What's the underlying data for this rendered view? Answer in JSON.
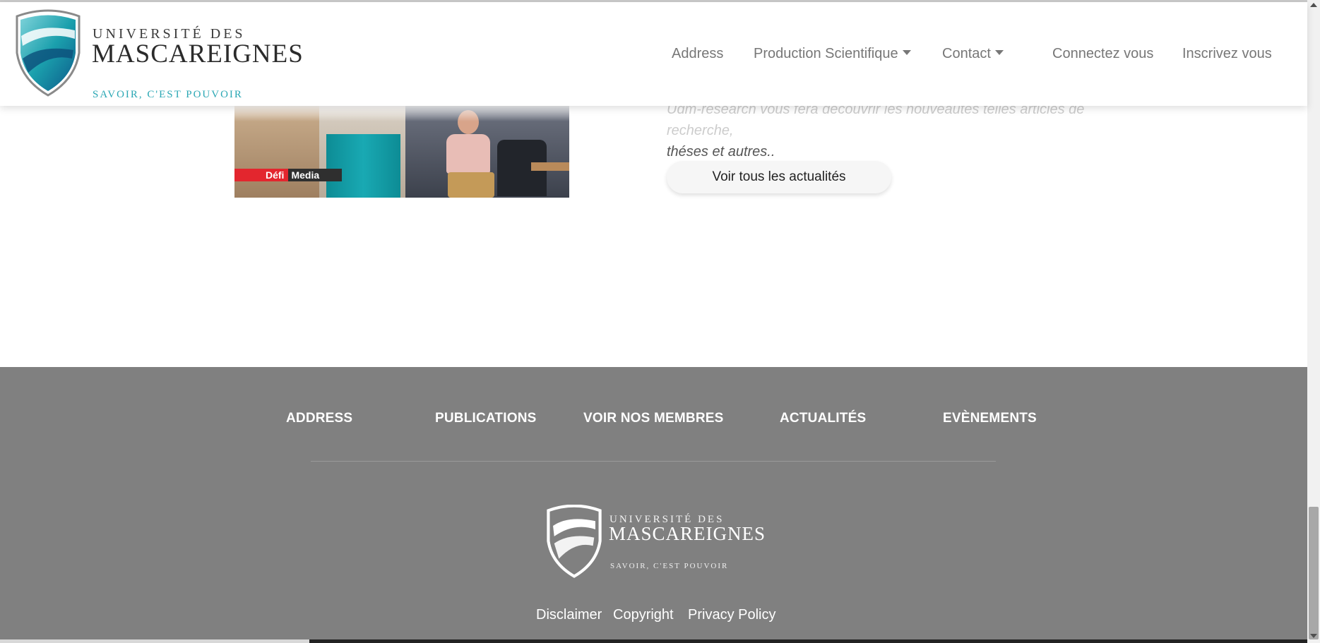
{
  "header": {
    "logo": {
      "line1": "UNIVERSITÉ DES",
      "line2": "MASCAREIGNES",
      "tagline": "SAVOIR, C'EST POUVOIR"
    },
    "nav": [
      {
        "label": "Address"
      },
      {
        "label": "Production Scientifique"
      },
      {
        "label": "Contact"
      },
      {
        "label": "Connectez vous"
      },
      {
        "label": "Inscrivez vous"
      }
    ]
  },
  "news": {
    "image_badge": {
      "red": "Défi",
      "white": "Media"
    },
    "text_faded": "Udm-research vous fera découvrir les nouveautés telles articles de recherche,",
    "text": "théses et autres..",
    "button_label": "Voir tous les actualités"
  },
  "footer": {
    "links": [
      {
        "label": "ADDRESS"
      },
      {
        "label": "PUBLICATIONS"
      },
      {
        "label": "VOIR NOS MEMBRES"
      },
      {
        "label": "ACTUALITÉS"
      },
      {
        "label": "EVÈNEMENTS"
      }
    ],
    "logo": {
      "line1": "UNIVERSITÉ DES",
      "line2": "MASCAREIGNES",
      "tagline": "SAVOIR, C'EST POUVOIR"
    },
    "legal": [
      {
        "label": "Disclaimer"
      },
      {
        "label": "Copyright"
      },
      {
        "label": "Privacy Policy"
      }
    ]
  },
  "colors": {
    "accent": "#2aa7b4",
    "footer_bg": "#808080",
    "nav_text": "#777777"
  }
}
